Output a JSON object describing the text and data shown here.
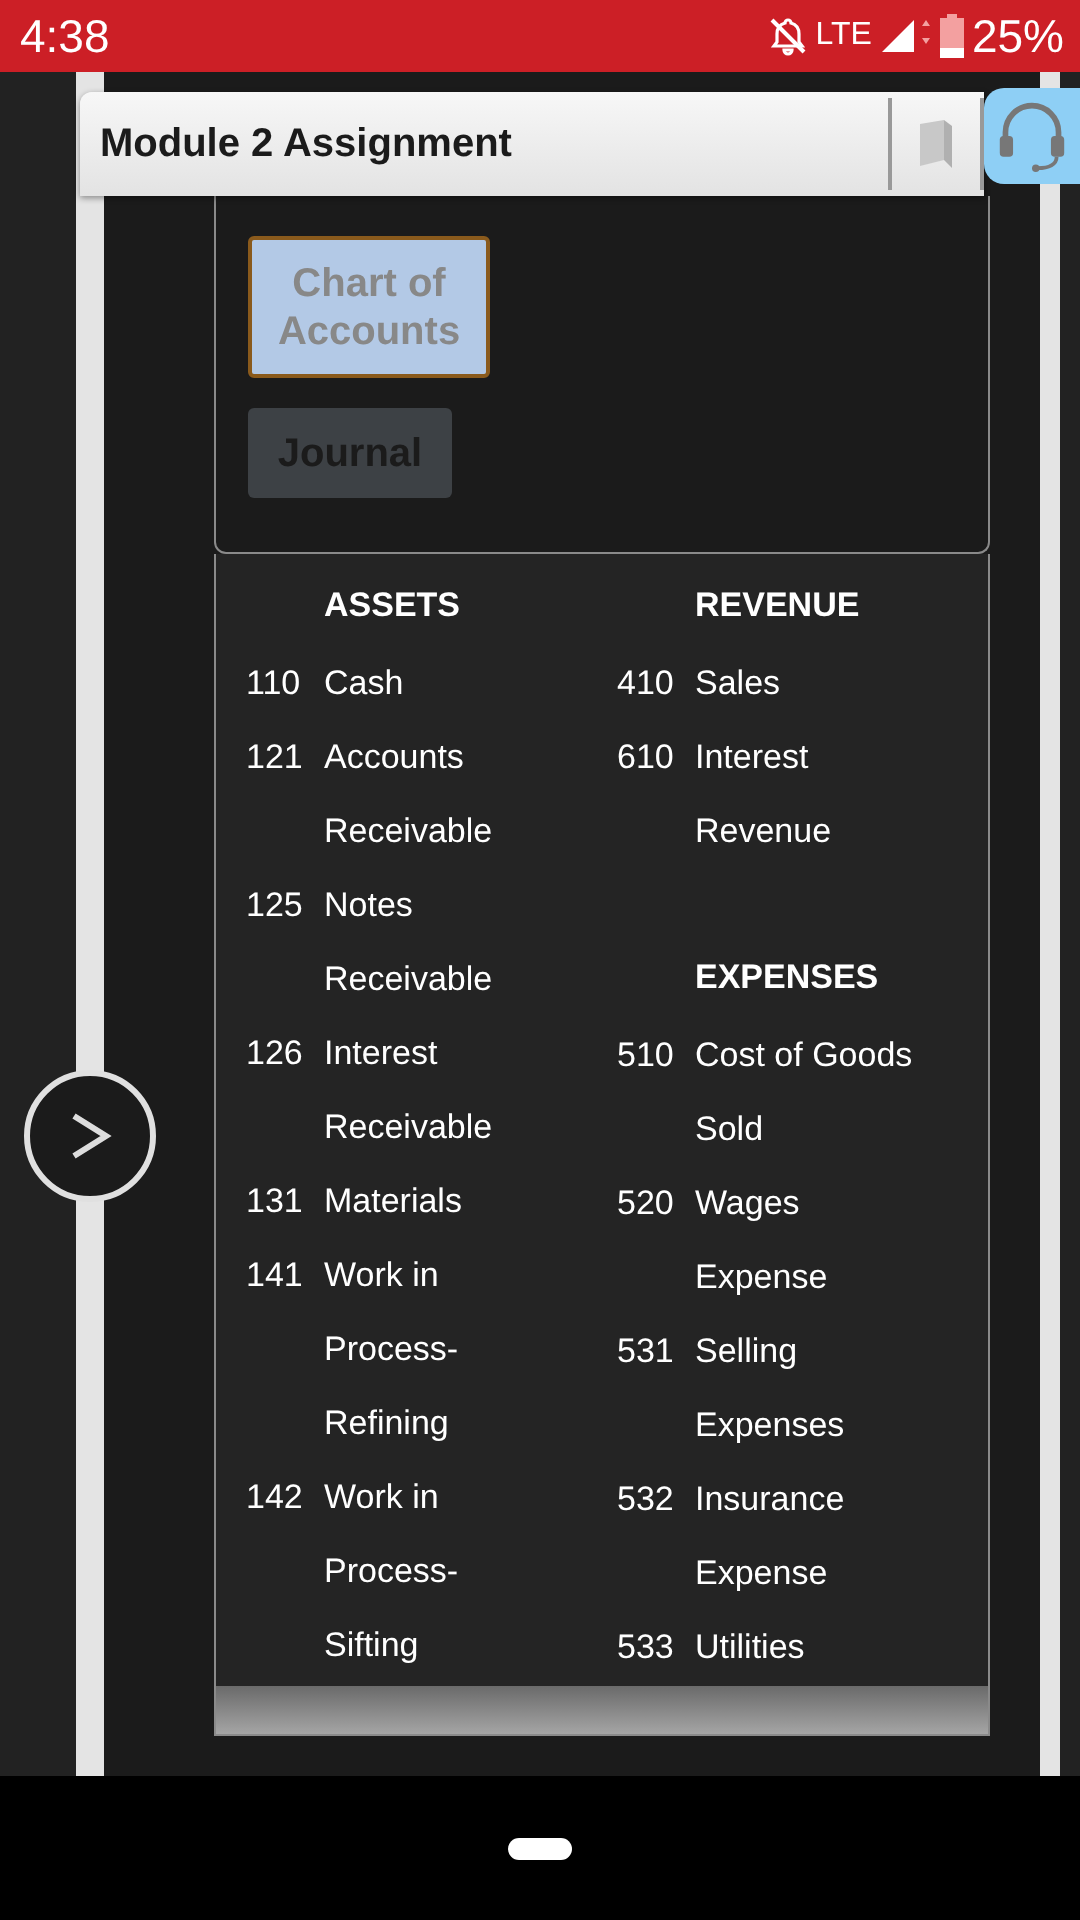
{
  "status_bar": {
    "time": "4:38",
    "network": "LTE",
    "battery": "25%"
  },
  "header": {
    "title": "Module 2 Assignment"
  },
  "view_buttons": [
    {
      "label": "Chart of Accounts",
      "selected": true
    },
    {
      "label": "Journal",
      "selected": false
    }
  ],
  "chart_of_accounts": {
    "columns": [
      {
        "sections": [
          {
            "heading": "ASSETS",
            "accounts": [
              {
                "number": "110",
                "name": "Cash"
              },
              {
                "number": "121",
                "name": "Accounts Receivable"
              },
              {
                "number": "125",
                "name": "Notes Receivable"
              },
              {
                "number": "126",
                "name": "Interest Receivable"
              },
              {
                "number": "131",
                "name": "Materials"
              },
              {
                "number": "141",
                "name": "Work in Process-Refining"
              },
              {
                "number": "142",
                "name": "Work in Process-Sifting"
              }
            ]
          }
        ]
      },
      {
        "sections": [
          {
            "heading": "REVENUE",
            "accounts": [
              {
                "number": "410",
                "name": "Sales"
              },
              {
                "number": "610",
                "name": "Interest Revenue"
              }
            ]
          },
          {
            "heading": "EXPENSES",
            "accounts": [
              {
                "number": "510",
                "name": "Cost of Goods Sold"
              },
              {
                "number": "520",
                "name": "Wages Expense"
              },
              {
                "number": "531",
                "name": "Selling Expenses"
              },
              {
                "number": "532",
                "name": "Insurance Expense"
              },
              {
                "number": "533",
                "name": "Utilities"
              }
            ]
          }
        ]
      }
    ]
  }
}
